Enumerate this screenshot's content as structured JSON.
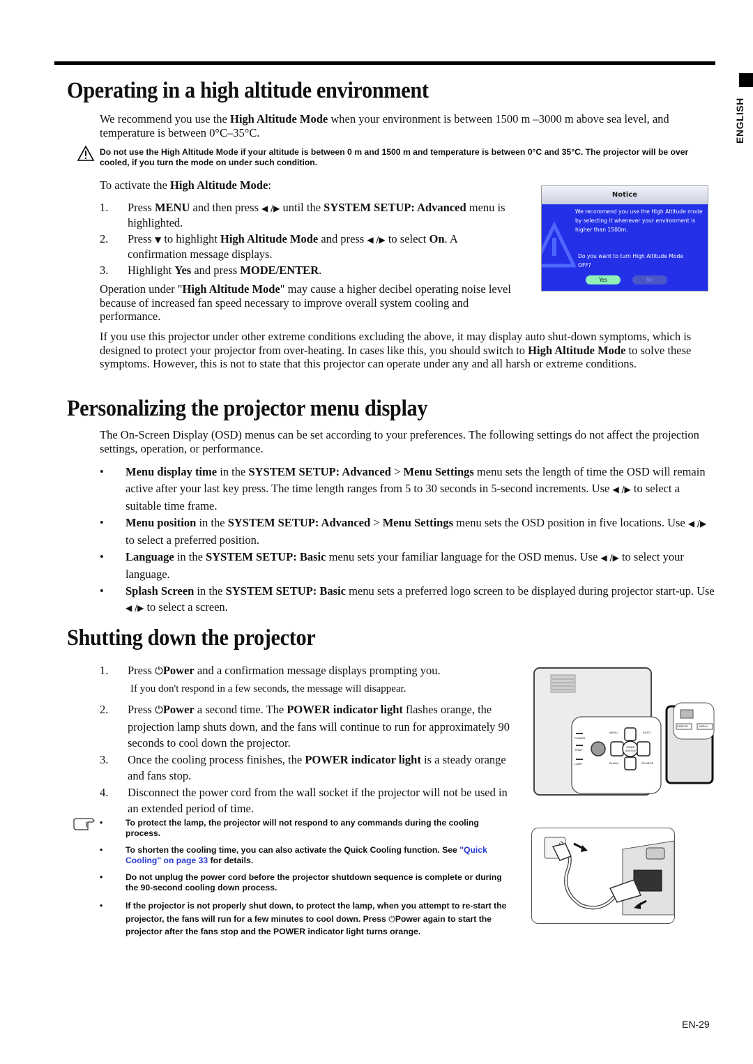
{
  "side_tab": {
    "label": "ENGLISH"
  },
  "section1": {
    "title": "Operating in a high altitude environment",
    "intro": [
      "We recommend you use the ",
      "High Altitude Mode",
      " when your environment is between 1500 m –3000 m above sea level, and temperature is between 0°C–35°C."
    ],
    "warning": "Do not use the High Altitude Mode if your altitude is between 0 m and 1500 m and temperature is between 0°C and 35°C. The projector will be over cooled, if you turn the mode on under such condition.",
    "activate_lead": [
      "To activate the ",
      "High Altitude Mode",
      ":"
    ],
    "steps": [
      {
        "num": "1.",
        "a": "Press ",
        "b": "MENU",
        "c": " and then press ",
        "arrows": "◀ /▶",
        "d": " until the ",
        "e": "SYSTEM SETUP: Advanced",
        "f": " menu is highlighted."
      },
      {
        "num": "2.",
        "a": "Press ",
        "down": "▼",
        "b": " to highlight ",
        "c": "High Altitude Mode",
        "d": " and press ",
        "arrows": "◀ /▶",
        "e": " to select ",
        "f": "On",
        "g": ". A confirmation message displays."
      },
      {
        "num": "3.",
        "a": "Highlight ",
        "b": "Yes",
        "c": " and press ",
        "d": "MODE/ENTER",
        "e": "."
      }
    ],
    "operation_note": [
      "Operation under \"",
      "High Altitude Mode",
      "\" may cause a higher decibel operating noise level because of increased fan speed necessary to improve overall system cooling and performance."
    ],
    "extreme": [
      "If you use this projector under other extreme conditions excluding the above, it may display auto shut-down symptoms, which is designed to protect your projector from over-heating. In cases like this, you should switch to ",
      "High Altitude Mode",
      " to solve these symptoms. However, this is not to state that this projector can operate under any and all harsh or extreme conditions."
    ],
    "osd_dialog": {
      "title": "Notice",
      "message": "We recommend you use the High Altitude mode by selecting it whenever your environment is higher than 1500m.",
      "question": "Do you want to turn High Altitude Mode OFF?",
      "yes": "Yes",
      "no": "No",
      "colors": {
        "body": "#2330e8",
        "yes": "#8ff0b8",
        "no": "#4a56c8"
      }
    }
  },
  "section2": {
    "title": "Personalizing the projector menu display",
    "intro": "The On-Screen Display (OSD) menus can be set according to your preferences. The following settings do not affect the projection settings, operation, or performance.",
    "bullets": [
      {
        "b1": "Menu display time",
        "t1": " in the ",
        "b2": "SYSTEM SETUP: Advanced",
        "t2": " > ",
        "b3": "Menu Settings",
        "t3": " menu sets the length of time the OSD will remain active after your last key press. The time length ranges from 5 to 30 seconds in 5-second increments. Use ",
        "arrows": "◀ /▶",
        "t4": " to select a suitable time frame."
      },
      {
        "b1": "Menu position",
        "t1": " in the ",
        "b2": "SYSTEM SETUP: Advanced",
        "t2": " > ",
        "b3": "Menu Settings",
        "t3": " menu sets the OSD position in five locations. Use ",
        "arrows": "◀ /▶",
        "t4": " to select a preferred position."
      },
      {
        "b1": "Language",
        "t1": " in the ",
        "b2": "SYSTEM SETUP: Basic",
        "t2": "",
        "b3": "",
        "t3": " menu sets your familiar language for the OSD menus. Use ",
        "arrows": "◀ /▶",
        "t4": " to select your language."
      },
      {
        "b1": "Splash Screen",
        "t1": " in the ",
        "b2": "SYSTEM SETUP: Basic",
        "t2": "",
        "b3": "",
        "t3": " menu sets a preferred logo screen to be displayed during projector start-up. Use ",
        "arrows": "◀ /▶",
        "t4": " to select a screen."
      }
    ]
  },
  "section3": {
    "title": "Shutting down the projector",
    "steps": [
      {
        "num": "1.",
        "a": "Press ",
        "icon": "⏻",
        "b": "Power",
        "c": " and a confirmation message displays prompting you.",
        "sub": "If you don't respond in a few seconds, the message will disappear."
      },
      {
        "num": "2.",
        "a": "Press ",
        "icon": "⏻",
        "b": "Power",
        "c": " a second time. The ",
        "d": "POWER indicator light",
        "e": " flashes orange, the projection lamp shuts down, and the fans will continue to run for approximately 90 seconds to cool down the projector."
      },
      {
        "num": "3.",
        "a": "Once the cooling process finishes, the ",
        "b": "POWER indicator light",
        "c": " is a steady orange and fans stop."
      },
      {
        "num": "4.",
        "a": "Disconnect the power cord from the wall socket if the projector will not be used in an extended period of time."
      }
    ],
    "notes": [
      {
        "text": "To protect the lamp, the projector will not respond to any commands during the cooling process."
      },
      {
        "text": "To shorten the cooling time, you can also activate the Quick Cooling function. See ",
        "link": "\"Quick Cooling\" on page 33",
        "after": " for details."
      },
      {
        "text": " Do not unplug the power cord before the projector shutdown sequence is complete or during the 90-second cooling down process."
      },
      {
        "text": "If the projector is not properly shut down, to protect the lamp, when you attempt to re-start the projector, the fans will run for a few minutes to cool down. Press ",
        "icon": "⏻",
        "after": "Power again to start the projector after the fans stop and the POWER indicator light turns orange."
      }
    ],
    "control_panel": {
      "indicators": [
        "POWER",
        "TEMP",
        "LAMP"
      ],
      "keys": [
        "MENU",
        "AUTO",
        "MODE /ENTER",
        "BLANK",
        "SOURCE"
      ],
      "remote_keys": [
        "FREEZE",
        "MENU"
      ]
    }
  },
  "footer": {
    "page_number": "EN-29"
  }
}
